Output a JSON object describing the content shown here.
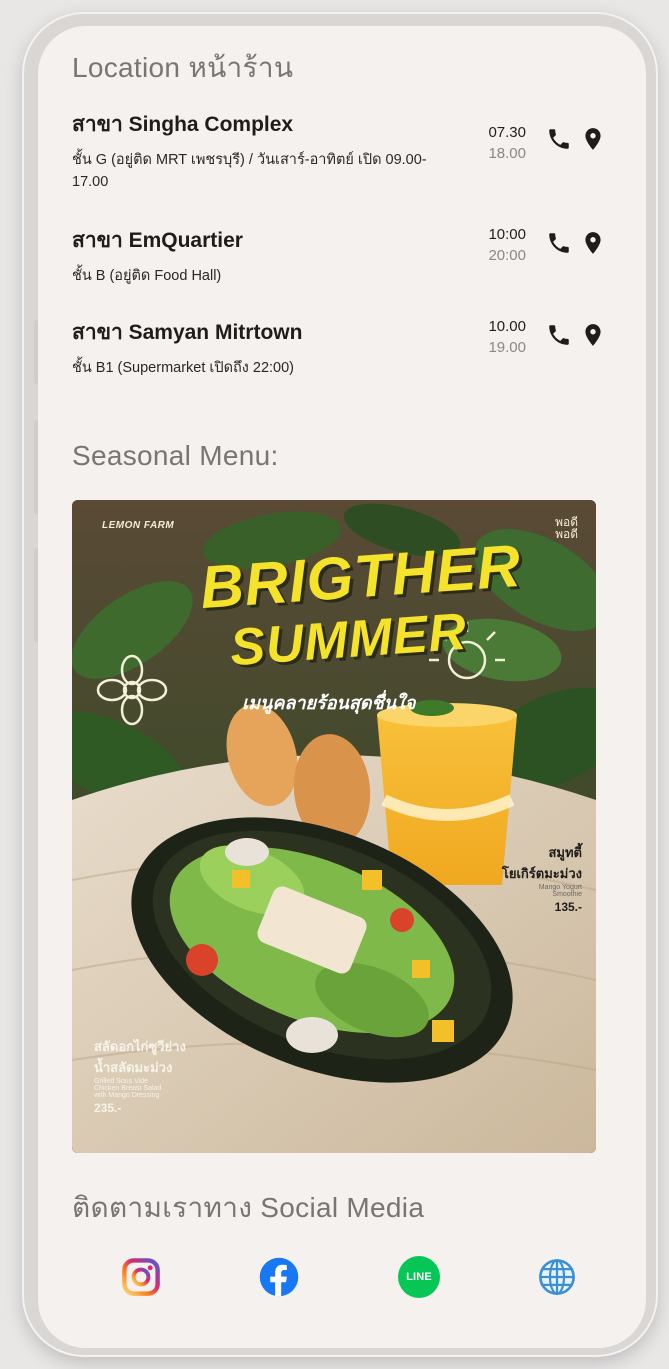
{
  "location": {
    "title": "Location หน้าร้าน",
    "branches": [
      {
        "name": "สาขา Singha Complex",
        "detail": "ชั้น G (อยู่ติด MRT เพชรบุรี) / วันเสาร์-อาทิตย์ เปิด 09.00-17.00",
        "open": "07.30",
        "close": "18.00",
        "phone_icon": "phone-icon",
        "pin_icon": "map-pin-icon"
      },
      {
        "name": "สาขา EmQuartier",
        "detail": "ชั้น B (อยู่ติด Food Hall)",
        "open": "10:00",
        "close": "20:00",
        "phone_icon": "phone-icon",
        "pin_icon": "map-pin-icon"
      },
      {
        "name": "สาขา Samyan Mitrtown",
        "detail": "ชั้น B1 (Supermarket เปิดถึง 22:00)",
        "open": "10.00",
        "close": "19.00",
        "phone_icon": "phone-icon",
        "pin_icon": "map-pin-icon"
      }
    ]
  },
  "seasonal": {
    "title": "Seasonal Menu:",
    "poster": {
      "brand_left": "LEMON FARM",
      "brand_right_1": "พอดี",
      "brand_right_2": "พอดี",
      "headline_1": "BRIGTHER",
      "headline_2": "SUMMER",
      "subtitle": "เมนูคลายร้อนสุดชื่นใจ",
      "drink": {
        "name_th_1": "สมูทตี้",
        "name_th_2": "โยเกิร์ตมะม่วง",
        "name_en_1": "Mango Yogurt",
        "name_en_2": "Smoothie",
        "price": "135.-"
      },
      "salad": {
        "name_th_1": "สลัดอกไก่ซูวีย่าง",
        "name_th_2": "น้ำสลัดมะม่วง",
        "name_en_1": "Grilled Sous Vide",
        "name_en_2": "Chicken Breast Salad",
        "name_en_3": "with Mango Dressing",
        "price": "235.-"
      }
    }
  },
  "social": {
    "title": "ติดตามเราทาง Social Media",
    "icons": [
      "instagram-icon",
      "facebook-icon",
      "line-icon",
      "website-globe-icon"
    ],
    "line_label": "LINE",
    "colors": {
      "facebook": "#1877f2",
      "line": "#06c755",
      "globe": "#3a8fd6"
    }
  }
}
